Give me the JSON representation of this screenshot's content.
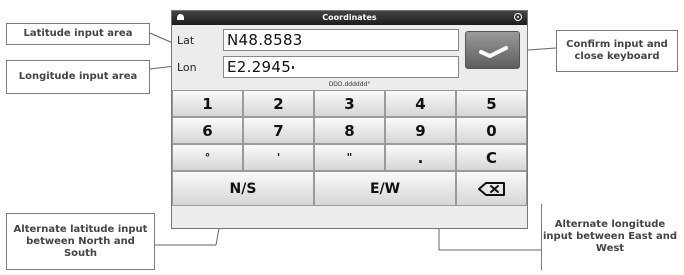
{
  "window": {
    "title": "Coordinates"
  },
  "fields": {
    "lat_label": "Lat",
    "lat_value": "N48.8583",
    "lon_label": "Lon",
    "lon_value": "E2.2945"
  },
  "format_hint": "DDD.dddddd°",
  "keypad": {
    "row1": [
      "1",
      "2",
      "3",
      "4",
      "5"
    ],
    "row2": [
      "6",
      "7",
      "8",
      "9",
      "0"
    ],
    "row3": [
      "°",
      "'",
      "\"",
      ".",
      "C"
    ],
    "ns": "N/S",
    "ew": "E/W"
  },
  "annotations": {
    "latitude": "Latitude input area",
    "longitude": "Longitude input area",
    "confirm": "Confirm input and close keyboard",
    "north_south": "Alternate latitude input between North and South",
    "east_west": "Alternate longitude input between East and West"
  },
  "icons": {
    "confirm": "checkmark-icon",
    "backspace": "backspace-icon",
    "title_left": "menu-icon",
    "title_right": "location-icon"
  }
}
